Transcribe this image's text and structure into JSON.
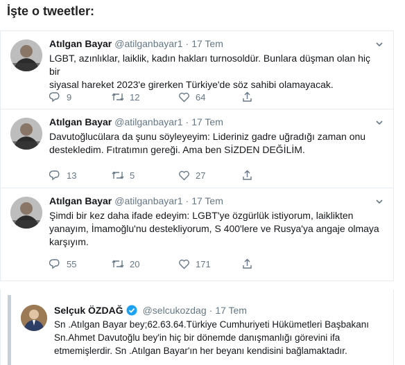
{
  "heading": "İşte o tweetler:",
  "tweets": [
    {
      "name": "Atılgan Bayar",
      "handle": "@atilganbayar1",
      "date": "17 Tem",
      "line1": "LGBT, azınlıklar, laiklik, kadın hakları turnosoldür. Bunlara düşman olan hiç bir",
      "line2": "siyasal hareket 2023'e girerken Türkiye'de söz sahibi olamayacak.",
      "line3": "",
      "replies": "9",
      "retweets": "12",
      "likes": "64"
    },
    {
      "name": "Atılgan Bayar",
      "handle": "@atilganbayar1",
      "date": "17 Tem",
      "line1": "Davutoğlucülara da şunu söyleyeyim: Lideriniz gadre uğradığı zaman onu",
      "line2": "destekledim. Fıtratımın gereği. Ama ben SİZDEN DEĞİLİM.",
      "line3": "",
      "replies": "13",
      "retweets": "5",
      "likes": "27"
    },
    {
      "name": "Atılgan Bayar",
      "handle": "@atilganbayar1",
      "date": "17 Tem",
      "line1": "Şimdi bir kez daha ifade edeyim: LGBT'ye özgürlük istiyorum, laiklikten",
      "line2": "yanayım, İmamoğlu'nu destekliyorum, S 400'lere ve Rusya'ya angaje olmaya",
      "line3": "karşıyım.",
      "replies": "55",
      "retweets": "20",
      "likes": "171"
    }
  ],
  "quoted": {
    "name": "Selçuk ÖZDAĞ",
    "handle": "@selcukozdag",
    "date": "17 Tem",
    "line1": "Sn .Atılgan Bayar bey;62.63.64.Türkiye Cumhuriyeti Hükümetleri Başbakanı",
    "line2": "Sn.Ahmet Davutoğlu bey'in hiç bir dönemde danışmanlığı görevini ifa",
    "line3": "etmemişlerdir. Sn .Atılgan Bayar'ın her beyanı kendisini bağlamaktadır."
  },
  "icons": [
    "reply-icon",
    "retweet-icon",
    "like-icon",
    "share-icon",
    "caret-down-icon",
    "verified-badge-icon"
  ],
  "colors": {
    "meta_gray": "#657786",
    "border": "#e6ecf0",
    "verified_blue": "#1da1f2"
  }
}
